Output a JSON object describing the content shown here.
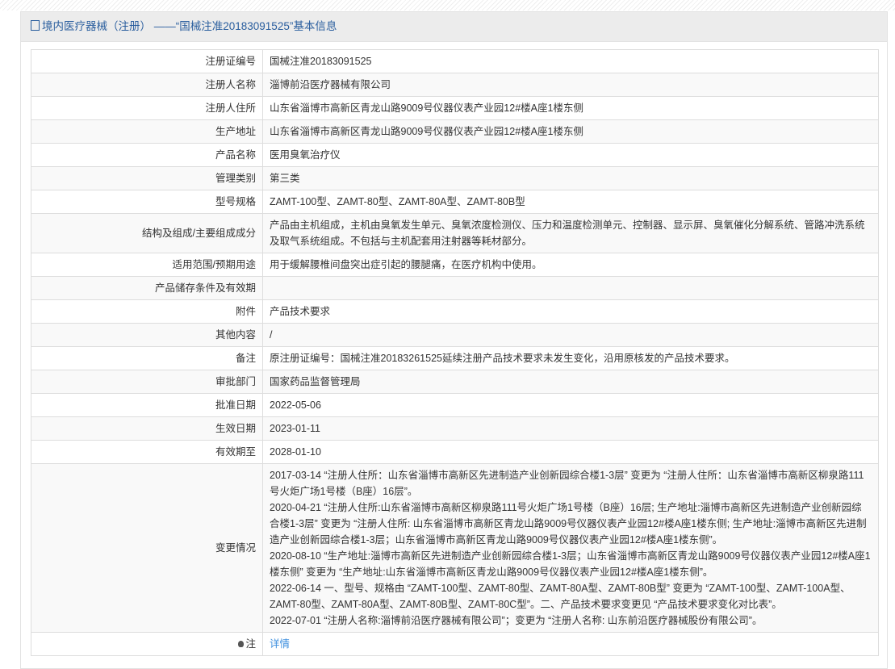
{
  "header": {
    "title": "境内医疗器械（注册） ——“国械注准20183091525”基本信息",
    "icon": "document-icon"
  },
  "rows": [
    {
      "label": "注册证编号",
      "value": "国械注准20183091525"
    },
    {
      "label": "注册人名称",
      "value": "淄博前沿医疗器械有限公司"
    },
    {
      "label": "注册人住所",
      "value": "山东省淄博市高新区青龙山路9009号仪器仪表产业园12#楼A座1楼东侧"
    },
    {
      "label": "生产地址",
      "value": "山东省淄博市高新区青龙山路9009号仪器仪表产业园12#楼A座1楼东侧"
    },
    {
      "label": "产品名称",
      "value": "医用臭氧治疗仪"
    },
    {
      "label": "管理类别",
      "value": "第三类"
    },
    {
      "label": "型号规格",
      "value": "ZAMT-100型、ZAMT-80型、ZAMT-80A型、ZAMT-80B型"
    },
    {
      "label": "结构及组成/主要组成成分",
      "value": "产品由主机组成，主机由臭氧发生单元、臭氧浓度检测仪、压力和温度检测单元、控制器、显示屏、臭氧催化分解系统、管路冲洗系统及取气系统组成。不包括与主机配套用注射器等耗材部分。"
    },
    {
      "label": "适用范围/预期用途",
      "value": "用于缓解腰椎间盘突出症引起的腰腿痛，在医疗机构中使用。"
    },
    {
      "label": "产品储存条件及有效期",
      "value": ""
    },
    {
      "label": "附件",
      "value": "产品技术要求"
    },
    {
      "label": "其他内容",
      "value": "/"
    },
    {
      "label": "备注",
      "value": "原注册证编号：国械注准20183261525延续注册产品技术要求未发生变化，沿用原核发的产品技术要求。"
    },
    {
      "label": "审批部门",
      "value": "国家药品监督管理局"
    },
    {
      "label": "批准日期",
      "value": "2022-05-06"
    },
    {
      "label": "生效日期",
      "value": "2023-01-11"
    },
    {
      "label": "有效期至",
      "value": "2028-01-10"
    }
  ],
  "changes": {
    "label": "变更情况",
    "items": [
      "2017-03-14 “注册人住所：山东省淄博市高新区先进制造产业创新园综合楼1-3层” 变更为 “注册人住所：山东省淄博市高新区柳泉路111号火炬广场1号楼（B座）16层”。",
      "2020-04-21 “注册人住所:山东省淄博市高新区柳泉路111号火炬广场1号楼（B座）16层; 生产地址:淄博市高新区先进制造产业创新园综合楼1-3层” 变更为 “注册人住所: 山东省淄博市高新区青龙山路9009号仪器仪表产业园12#楼A座1楼东侧; 生产地址:淄博市高新区先进制造产业创新园综合楼1-3层；山东省淄博市高新区青龙山路9009号仪器仪表产业园12#楼A座1楼东侧”。",
      "2020-08-10 “生产地址:淄博市高新区先进制造产业创新园综合楼1-3层；山东省淄博市高新区青龙山路9009号仪器仪表产业园12#楼A座1楼东侧” 变更为 “生产地址:山东省淄博市高新区青龙山路9009号仪器仪表产业园12#楼A座1楼东侧”。",
      "2022-06-14 一、型号、规格由 “ZAMT-100型、ZAMT-80型、ZAMT-80A型、ZAMT-80B型” 变更为 “ZAMT-100型、ZAMT-100A型、ZAMT-80型、ZAMT-80A型、ZAMT-80B型、ZAMT-80C型”。二、产品技术要求变更见 “产品技术要求变化对比表”。",
      "2022-07-01 “注册人名称:淄博前沿医疗器械有限公司”；变更为 “注册人名称: 山东前沿医疗器械股份有限公司”。"
    ]
  },
  "note": {
    "label": "注",
    "link": "详情",
    "icon": "lightbulb-icon"
  }
}
